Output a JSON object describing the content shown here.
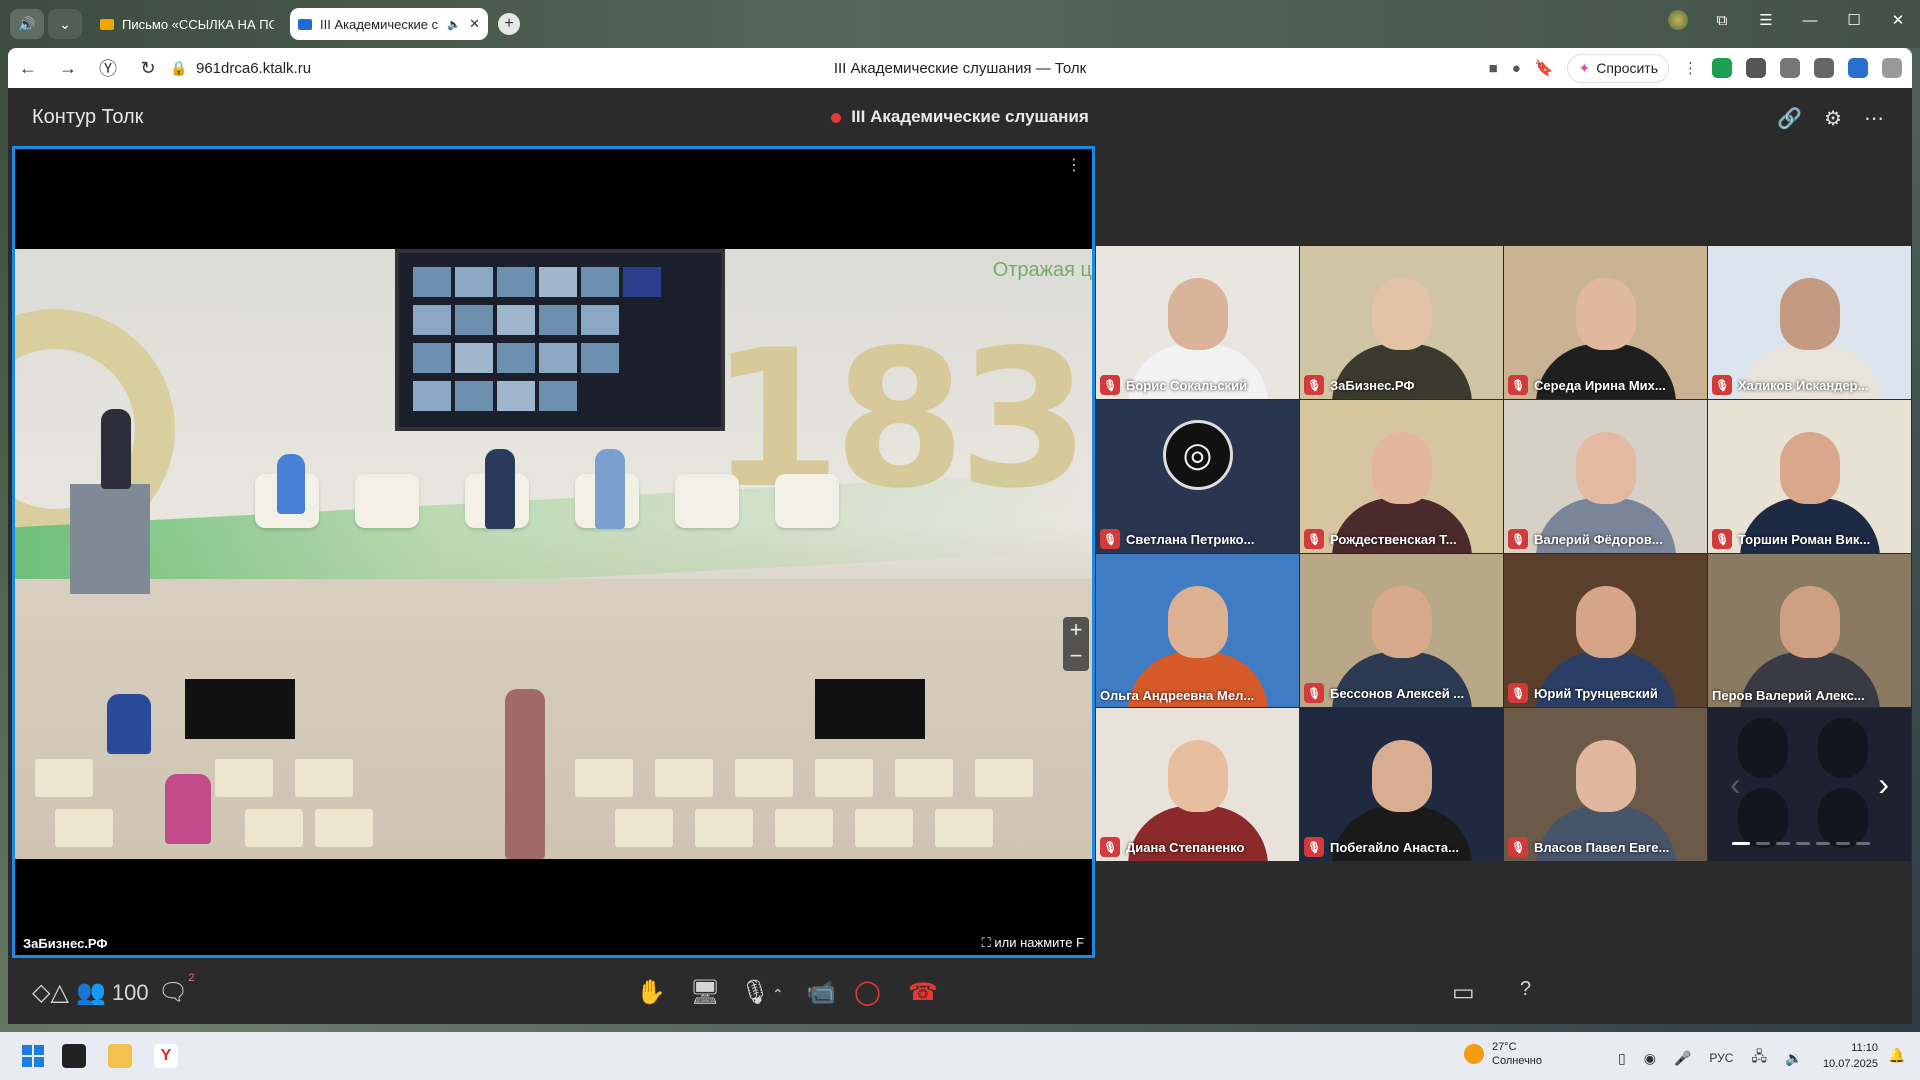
{
  "browser": {
    "tabs": [
      {
        "title": "Письмо «ССЫЛКА НА ПО",
        "icon_color": "#f0a500",
        "active": false
      },
      {
        "title": "III Академические с",
        "icon_color": "#1e6bd6",
        "active": true
      }
    ],
    "url": "961drca6.ktalk.ru",
    "page_title": "III Академические слушания — Толк",
    "ask_label": "Спросить"
  },
  "app": {
    "brand": "Контур Толк",
    "meeting_title": "III Академические слушания",
    "accent": "#1e88e5",
    "record_color": "#e53935"
  },
  "main_video": {
    "name": "ЗаБизнес.РФ",
    "fullscreen_hint": "или нажмите F",
    "wall_number": "183",
    "wall_text": "Отражая ц"
  },
  "participants": [
    {
      "name": "Борис Сокальский",
      "bg": "#e9e6e0",
      "face": "#d9b49a",
      "shirt": "#f2f2f2"
    },
    {
      "name": "ЗаБизнес.РФ",
      "bg": "#cfc4a4",
      "face": "#e3c3a8",
      "shirt": "#3b3a2e"
    },
    {
      "name": "Середа Ирина Мих...",
      "bg": "#c9b392",
      "face": "#e0b89e",
      "shirt": "#1f1f1f"
    },
    {
      "name": "Халиков Искандер...",
      "bg": "#dce5ee",
      "face": "#c49a80",
      "shirt": "#e8e4dc"
    },
    {
      "name": "Светлана Петрико...",
      "bg": "#2a3550",
      "obs": true
    },
    {
      "name": "Рождественская Т...",
      "bg": "#d7c5a0",
      "face": "#e2b79c",
      "shirt": "#4a2a2a"
    },
    {
      "name": "Валерий Фёдоров...",
      "bg": "#d6d0c6",
      "face": "#e3b9a2",
      "shirt": "#7a8599"
    },
    {
      "name": "Торшин Роман Вик...",
      "bg": "#e8e2d4",
      "face": "#d9a88c",
      "shirt": "#1c2a44"
    },
    {
      "name": "Ольга Андреевна Мел...",
      "bg": "#3f7cc4",
      "face": "#dcb090",
      "shirt": "#d65a2a",
      "muted": false
    },
    {
      "name": "Бессонов Алексей ...",
      "bg": "#b9a887",
      "face": "#d8a98b",
      "shirt": "#2c3a52"
    },
    {
      "name": "Юрий Трунцевский",
      "bg": "#5a3f2c",
      "face": "#d6a487",
      "shirt": "#2b3f66"
    },
    {
      "name": "Перов Валерий Алекс...",
      "bg": "#8a7a62",
      "face": "#cf9f82",
      "shirt": "#3a3a44",
      "muted": false
    },
    {
      "name": "Диана Степаненко",
      "bg": "#e8e2da",
      "face": "#e7bfa0",
      "shirt": "#8a2a2a"
    },
    {
      "name": "Побегайло Анаста...",
      "bg": "#1f2a40",
      "face": "#d9ad92",
      "shirt": "#1a1a1a"
    },
    {
      "name": "Власов Павел Евге...",
      "bg": "#6b5a48",
      "face": "#e1b79d",
      "shirt": "#46556a"
    }
  ],
  "toolbar": {
    "participants_count": "100",
    "chat_badge": "2"
  },
  "taskbar": {
    "temperature": "27°C",
    "weather": "Солнечно",
    "lang": "РУС",
    "time": "11:10",
    "date": "10.07.2025"
  }
}
